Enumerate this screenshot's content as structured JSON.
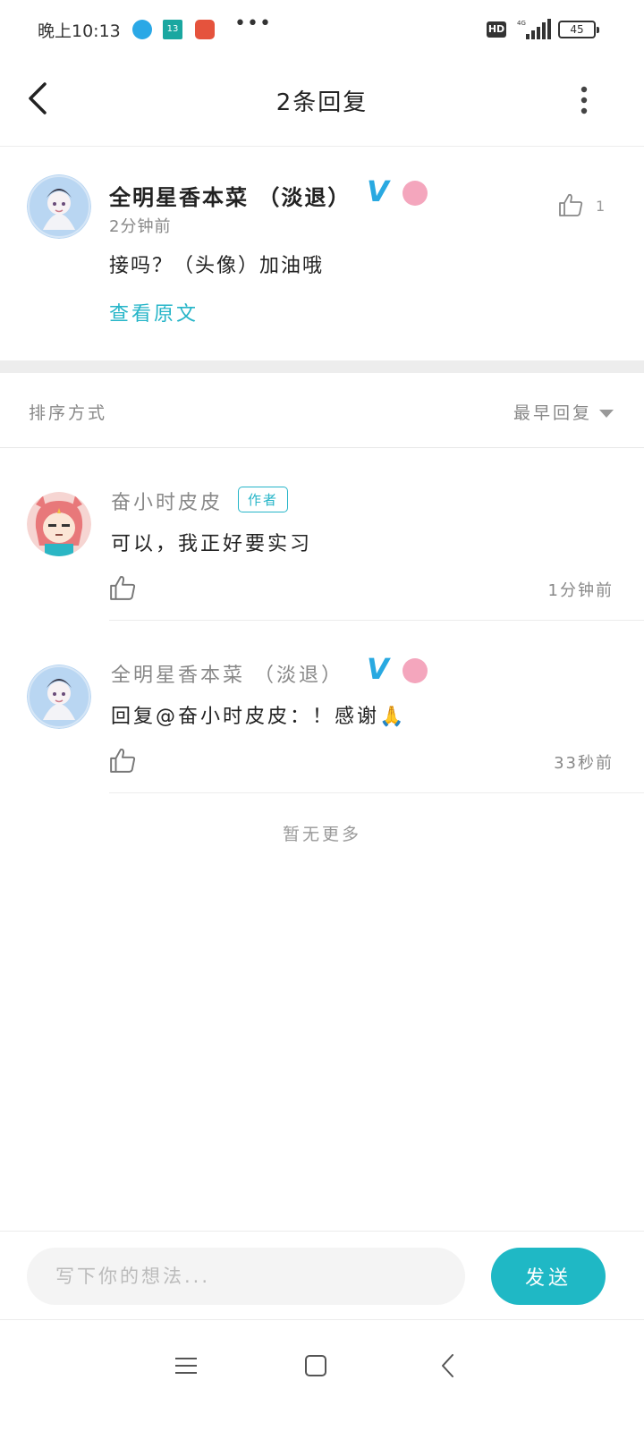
{
  "status_bar": {
    "time": "晚上10:13",
    "app_icon_2_label": "13",
    "overflow": "•••",
    "hd": "HD",
    "network": "4G",
    "battery": "45"
  },
  "header": {
    "title": "2条回复",
    "back_icon": "chevron-left-icon",
    "more_icon": "vertical-dots-icon"
  },
  "original_comment": {
    "author": "全明星香本菜 （淡退）",
    "time": "2分钟前",
    "text": "接吗？（头像）加油哦",
    "view_original": "查看原文",
    "like_count": "1",
    "verified_badge": "V"
  },
  "sort": {
    "label": "排序方式",
    "selected": "最早回复"
  },
  "replies": [
    {
      "author": "奋小时皮皮",
      "tag": "作者",
      "text": "可以，我正好要实习",
      "time": "1分钟前"
    },
    {
      "author": "全明星香本菜 （淡退）",
      "verified_badge": "V",
      "text": "回复@奋小时皮皮：！感谢🙏",
      "time": "33秒前"
    }
  ],
  "list_end": "暂无更多",
  "composer": {
    "placeholder": "写下你的想法...",
    "send_label": "发送"
  },
  "colors": {
    "accent": "#1fb8c5",
    "link": "#26b5c8",
    "verified": "#29a9e1"
  }
}
